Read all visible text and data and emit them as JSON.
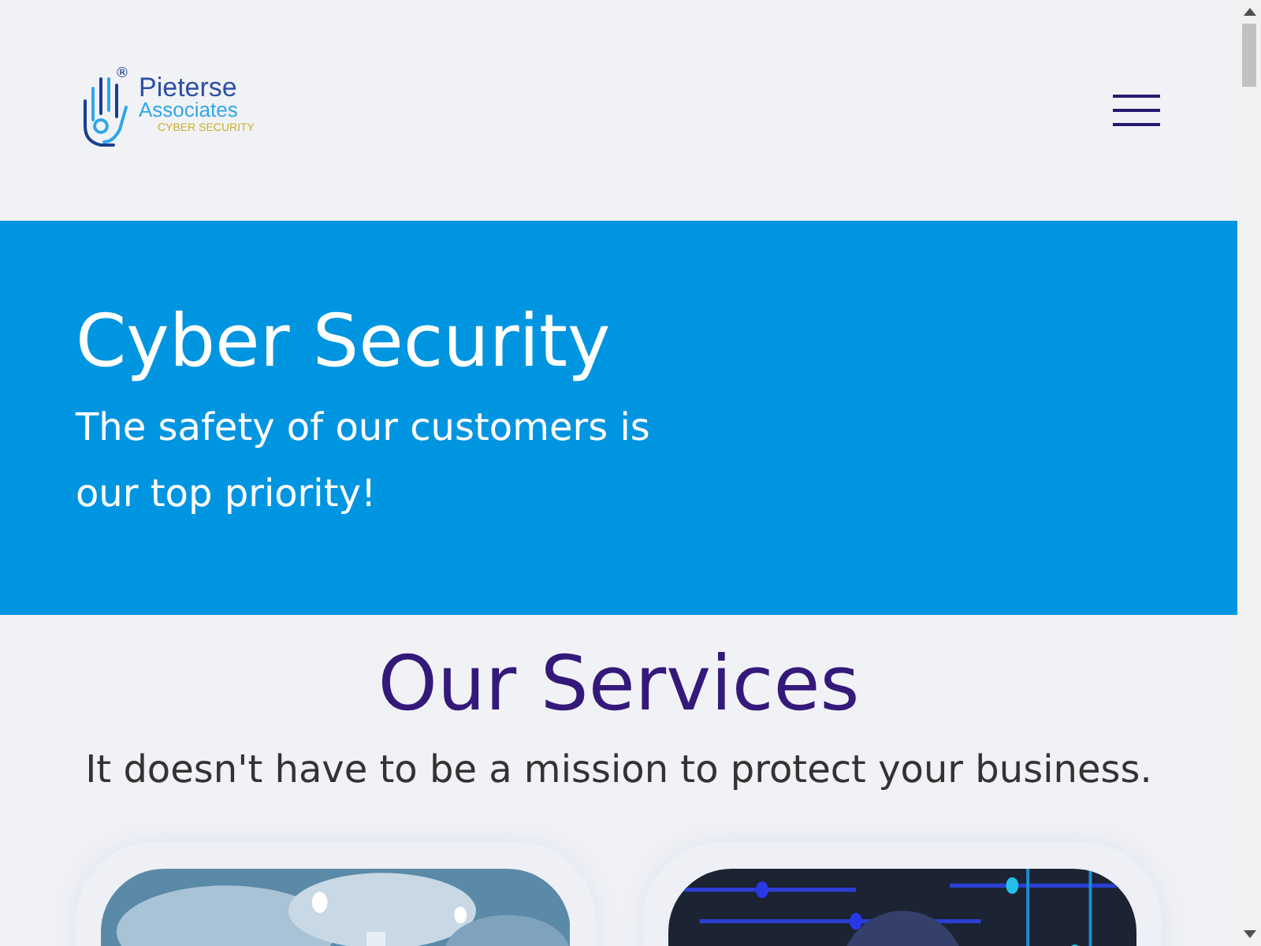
{
  "logo": {
    "name_line_1": "Pieterse",
    "name_line_2": "Associates",
    "tagline": "CYBER SECURITY",
    "mark": "®"
  },
  "hero": {
    "title": "Cyber Security",
    "subtitle": "The safety of our customers is our top priority!"
  },
  "services": {
    "title": "Our Services",
    "subtitle": "It doesn't have to be a mission to protect your business.",
    "cards": [
      {
        "kind": "cloud"
      },
      {
        "kind": "circuit"
      }
    ]
  }
}
